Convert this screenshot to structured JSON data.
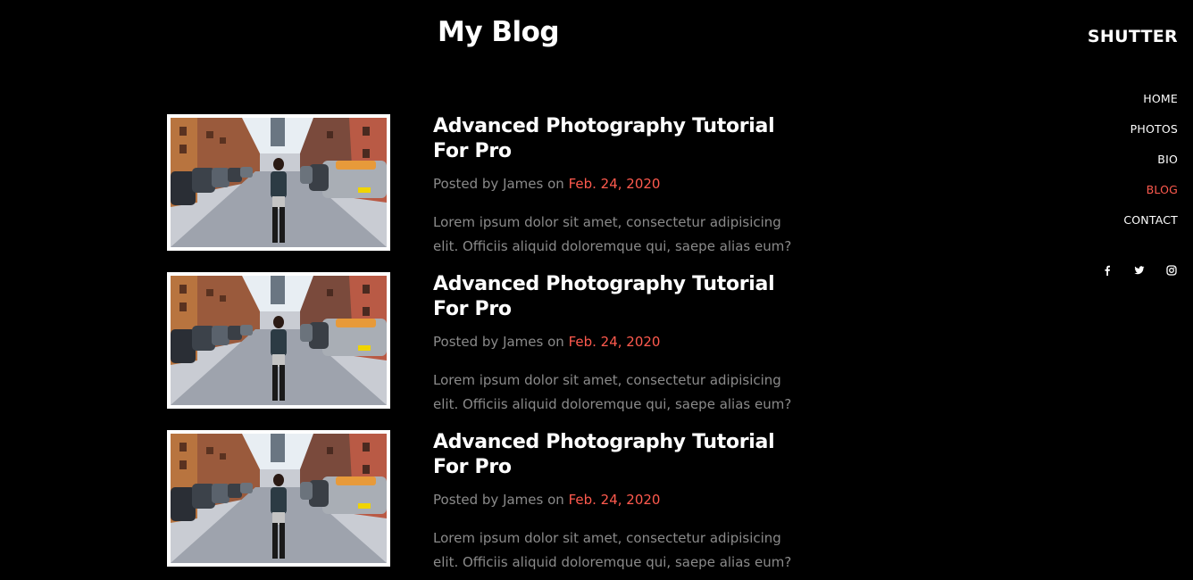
{
  "header": {
    "title": "My Blog"
  },
  "sidebar": {
    "brand": "SHUTTER",
    "nav": [
      {
        "label": "HOME",
        "active": false
      },
      {
        "label": "PHOTOS",
        "active": false
      },
      {
        "label": "BIO",
        "active": false
      },
      {
        "label": "BLOG",
        "active": true
      },
      {
        "label": "CONTACT",
        "active": false
      }
    ],
    "social": [
      "facebook-icon",
      "twitter-icon",
      "instagram-icon"
    ]
  },
  "posts": [
    {
      "title": "Advanced Photography Tutorial For Pro",
      "meta_prefix": "Posted by James on ",
      "date": "Feb. 24, 2020",
      "excerpt": "Lorem ipsum dolor sit amet, consectetur adipisicing elit. Officiis aliquid doloremque qui, saepe alias eum?",
      "image": "street-photo-woman-walking"
    },
    {
      "title": "Advanced Photography Tutorial For Pro",
      "meta_prefix": "Posted by James on ",
      "date": "Feb. 24, 2020",
      "excerpt": "Lorem ipsum dolor sit amet, consectetur adipisicing elit. Officiis aliquid doloremque qui, saepe alias eum?",
      "image": "street-photo-woman-walking"
    },
    {
      "title": "Advanced Photography Tutorial For Pro",
      "meta_prefix": "Posted by James on ",
      "date": "Feb. 24, 2020",
      "excerpt": "Lorem ipsum dolor sit amet, consectetur adipisicing elit. Officiis aliquid doloremque qui, saepe alias eum?",
      "image": "street-photo-woman-walking"
    }
  ],
  "colors": {
    "background": "#000000",
    "accent": "#ff5a4e",
    "muted_text": "#8a8a8a",
    "text": "#ffffff"
  }
}
